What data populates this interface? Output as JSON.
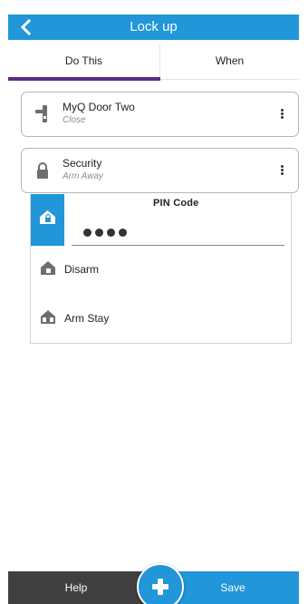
{
  "header": {
    "title": "Lock up",
    "back_icon": "chevron-left-icon"
  },
  "tabs": [
    {
      "label": "Do This",
      "active": true
    },
    {
      "label": "When",
      "active": false
    }
  ],
  "actions": [
    {
      "name": "MyQ Door Two",
      "state": "Close",
      "icon": "door-lock-icon",
      "menu_icon": "more-vert-icon"
    },
    {
      "name": "Security",
      "state": "Arm Away",
      "icon": "padlock-icon",
      "menu_icon": "more-vert-icon"
    }
  ],
  "security_options": {
    "pin_label": "PIN Code",
    "pin_dots": 4,
    "options": [
      {
        "label": "Disarm",
        "icon": "house-unlocked-icon"
      },
      {
        "label": "Arm Stay",
        "icon": "house-arm-stay-icon"
      }
    ]
  },
  "footer": {
    "help_label": "Help",
    "save_label": "Save",
    "add_icon": "plus-icon"
  },
  "colors": {
    "accent": "#2196d8",
    "tab_indicator": "#5b2d86",
    "footer_dark": "#404040"
  }
}
